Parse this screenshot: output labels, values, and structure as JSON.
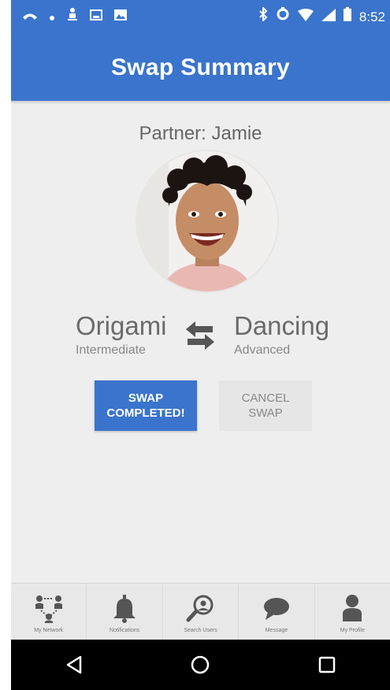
{
  "status_bar": {
    "time": "8:52",
    "left_icons": [
      "phone-icon",
      "dot-icon",
      "people-icon",
      "image-icon",
      "photo-icon"
    ],
    "right_icons": [
      "bluetooth-icon",
      "sync-icon",
      "wifi-icon",
      "signal-icon",
      "battery-icon"
    ]
  },
  "header": {
    "title": "Swap Summary"
  },
  "partner": {
    "label": "Partner: Jamie"
  },
  "swap": {
    "left_skill": "Origami",
    "left_level": "Intermediate",
    "right_skill": "Dancing",
    "right_level": "Advanced"
  },
  "buttons": {
    "complete_line1": "SWAP",
    "complete_line2": "COMPLETED!",
    "cancel_line1": "CANCEL",
    "cancel_line2": "SWAP"
  },
  "bottom_nav": {
    "items": [
      {
        "label": "My Network",
        "icon": "network-icon"
      },
      {
        "label": "Notifications",
        "icon": "bell-icon"
      },
      {
        "label": "Search Users",
        "icon": "search-icon"
      },
      {
        "label": "Message",
        "icon": "chat-icon"
      },
      {
        "label": "My Profile",
        "icon": "person-icon"
      }
    ]
  },
  "colors": {
    "primary": "#3a74cc",
    "background": "#eeeeee",
    "text_muted": "#6a6a6a"
  }
}
